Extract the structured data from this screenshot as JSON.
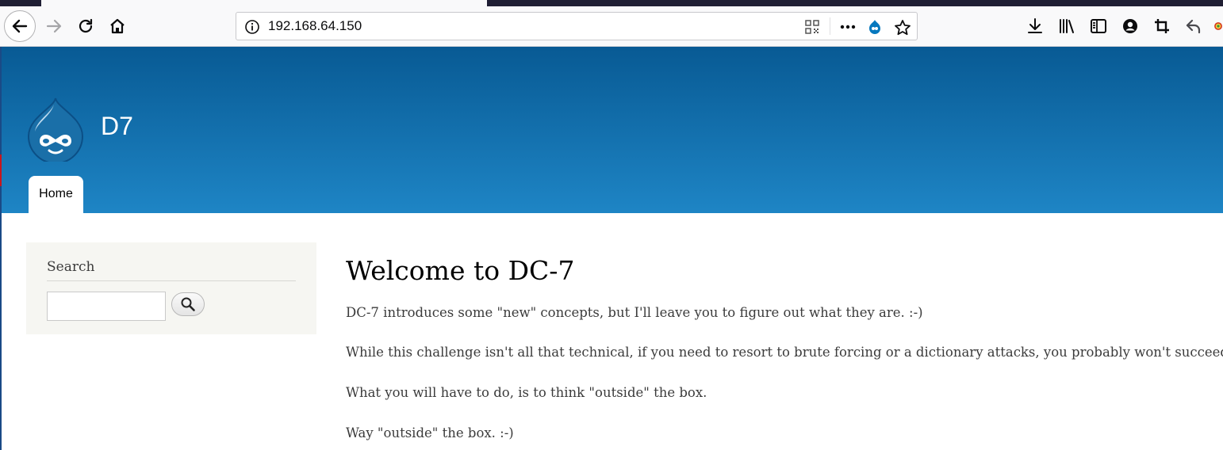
{
  "browser": {
    "url": "192.168.64.150"
  },
  "site": {
    "name": "D7",
    "nav": [
      {
        "label": "Home"
      }
    ]
  },
  "sidebar": {
    "search_title": "Search",
    "search_value": ""
  },
  "content": {
    "title": "Welcome to DC-7",
    "paragraphs": [
      "DC-7 introduces some \"new\" concepts, but I'll leave you to figure out what they are.  :-)",
      "While this challenge isn't all that technical, if you need to resort to brute forcing or a dictionary attacks, you probably won't succeed.",
      "What you will have to do, is to think \"outside\" the box.",
      "Way \"outside\" the box.  :-)"
    ]
  },
  "colors": {
    "header_top": "#085a94",
    "header_bottom": "#1e85c5",
    "sidebar_bg": "#f6f6f2",
    "text": "#3b3b3b"
  },
  "icons": {
    "toolbar": [
      "back-arrow-icon",
      "forward-arrow-icon",
      "reload-icon",
      "home-icon"
    ],
    "urlbar": [
      "info-icon",
      "qr-code-icon",
      "page-actions-icon",
      "drupal-icon",
      "bookmark-star-icon"
    ],
    "right": [
      "download-icon",
      "library-icon",
      "sidebar-icon",
      "account-icon",
      "crop-icon",
      "undo-icon",
      "extension-icon"
    ],
    "page": [
      "drupal-logo",
      "search-icon"
    ]
  }
}
